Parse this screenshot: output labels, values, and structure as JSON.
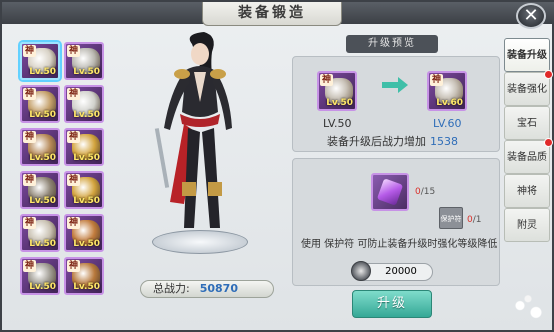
{
  "window": {
    "title": "装备锻造",
    "close_label": "✕"
  },
  "equipment": [
    {
      "tag": "神",
      "level": "Lv.50",
      "icon": "helmet-icon",
      "color": "#d8d2c6",
      "selected": true
    },
    {
      "tag": "神",
      "level": "Lv.50",
      "icon": "necklace-icon",
      "color": "#b9b7b0"
    },
    {
      "tag": "神",
      "level": "Lv.50",
      "icon": "pauldron-icon",
      "color": "#c4a06a"
    },
    {
      "tag": "神",
      "level": "Lv.50",
      "icon": "ring-icon",
      "color": "#d1d1cc"
    },
    {
      "tag": "神",
      "level": "Lv.50",
      "icon": "chestplate-icon",
      "color": "#b68958"
    },
    {
      "tag": "神",
      "level": "Lv.50",
      "icon": "bracer-icon",
      "color": "#d3a43e"
    },
    {
      "tag": "神",
      "level": "Lv.50",
      "icon": "belt-icon",
      "color": "#8e8475"
    },
    {
      "tag": "神",
      "level": "Lv.50",
      "icon": "bracer-icon",
      "color": "#d3a43e"
    },
    {
      "tag": "神",
      "level": "Lv.50",
      "icon": "greaves-icon",
      "color": "#c9c1b2"
    },
    {
      "tag": "神",
      "level": "Lv.50",
      "icon": "ring-icon",
      "color": "#c27c3d"
    },
    {
      "tag": "神",
      "level": "Lv.50",
      "icon": "boots-icon",
      "color": "#9e9a91"
    },
    {
      "tag": "神",
      "level": "Lv.50",
      "icon": "ring-icon",
      "color": "#b8793c"
    }
  ],
  "character": {
    "power_label": "总战力:",
    "power_value": "50870"
  },
  "preview": {
    "header": "升级预览",
    "current": {
      "tag": "神",
      "level_badge": "Lv.50",
      "level_text": "LV.50"
    },
    "next": {
      "tag": "神",
      "level_badge": "Lv.60",
      "level_text": "LV.60"
    },
    "increase_label": "装备升级后战力增加",
    "increase_value": "1538"
  },
  "materials": {
    "gem_count": "0",
    "gem_total": "/15",
    "charm_label": "保护符",
    "charm_count": "0",
    "charm_total": "/1",
    "tip": "使用 保护符 可防止装备升级时强化等级降低",
    "cost": "20000"
  },
  "upgrade_button": "升级",
  "tabs": [
    {
      "label": "装备升级",
      "active": true,
      "dot": false
    },
    {
      "label": "装备强化",
      "active": false,
      "dot": true
    },
    {
      "label": "宝石",
      "active": false,
      "dot": false
    },
    {
      "label": "装备品质",
      "active": false,
      "dot": true
    },
    {
      "label": "神将",
      "active": false,
      "dot": false
    },
    {
      "label": "附灵",
      "active": false,
      "dot": false
    }
  ],
  "colors": {
    "accent": "#2f6db8",
    "rarity_border": "#c792e6",
    "button": "#35a896",
    "alert_dot": "#e02a2a"
  }
}
